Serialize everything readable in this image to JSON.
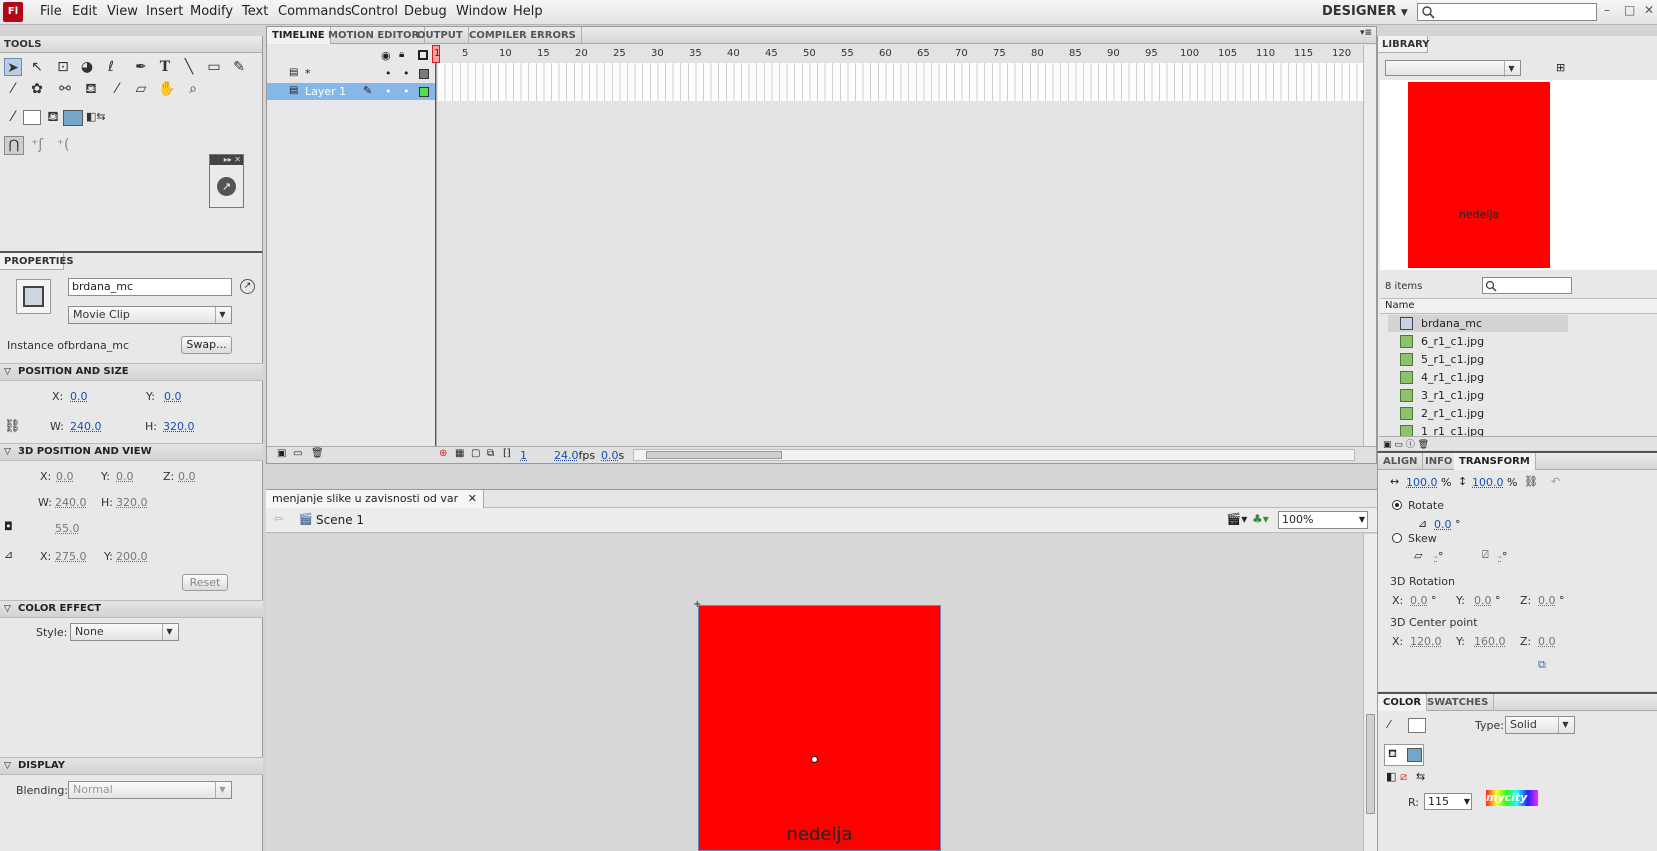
{
  "app": {
    "logo": "Fl",
    "menu": [
      "File",
      "Edit",
      "View",
      "Insert",
      "Modify",
      "Text",
      "Commands",
      "Control",
      "Debug",
      "Window",
      "Help"
    ],
    "workspace": "DESIGNER",
    "window_controls": [
      "–",
      "□",
      "✕"
    ]
  },
  "tools": {
    "header": "TOOLS",
    "icons": [
      "selection-tool",
      "subselection-tool",
      "free-transform-tool",
      "3d-rotation-tool",
      "lasso-tool",
      "pen-tool",
      "text-tool",
      "line-tool",
      "rectangle-tool",
      "pencil-tool",
      "brush-tool",
      "deco-tool",
      "bone-tool",
      "paint-bucket-tool",
      "eyedropper-tool",
      "eraser-tool",
      "hand-tool",
      "zoom-tool"
    ]
  },
  "timeline": {
    "tabs": [
      "TIMELINE",
      "MOTION EDITOR",
      "OUTPUT",
      "COMPILER ERRORS"
    ],
    "frame_numbers": [
      "1",
      "5",
      "10",
      "15",
      "20",
      "25",
      "30",
      "35",
      "40",
      "45",
      "50",
      "55",
      "60",
      "65",
      "70",
      "75",
      "80",
      "85",
      "90",
      "95",
      "100",
      "105",
      "110",
      "115",
      "120"
    ],
    "layers": [
      {
        "name": "*",
        "selected": false,
        "color": "#7a7a7a"
      },
      {
        "name": "Layer 1",
        "selected": true,
        "color": "#4fe04f"
      }
    ],
    "current_frame": "1",
    "fps": "24.0",
    "fps_unit": "fps",
    "elapsed": "0.0",
    "elapsed_unit": "s"
  },
  "document": {
    "tab_title": "menjanje slike u zavisnosti od var",
    "scene": "Scene 1",
    "zoom": "100%",
    "stage_text": "nedelja"
  },
  "properties": {
    "header": "PROPERTIES",
    "instance_name": "brdana_mc",
    "symbol_type": "Movie Clip",
    "instance_of_label": "Instance of:",
    "instance_of": "brdana_mc",
    "swap_button": "Swap...",
    "position_size": {
      "title": "POSITION AND SIZE",
      "x_label": "X:",
      "x": "0.0",
      "y_label": "Y:",
      "y": "0.0",
      "w_label": "W:",
      "w": "240.0",
      "h_label": "H:",
      "h": "320.0"
    },
    "position_3d": {
      "title": "3D POSITION AND VIEW",
      "x_label": "X:",
      "x": "0.0",
      "y_label": "Y:",
      "y": "0.0",
      "z_label": "Z:",
      "z": "0.0",
      "w_label": "W:",
      "w": "240.0",
      "h_label": "H:",
      "h": "320.0",
      "perspective": "55.0",
      "vx_label": "X:",
      "vx": "275.0",
      "vy_label": "Y:",
      "vy": "200.0",
      "reset_button": "Reset"
    },
    "color_effect": {
      "title": "COLOR EFFECT",
      "style_label": "Style:",
      "style": "None"
    },
    "display": {
      "title": "DISPLAY",
      "blending_label": "Blending:",
      "blending": "Normal"
    }
  },
  "library": {
    "header": "LIBRARY",
    "preview_text": "nedelja",
    "item_count": "8 items",
    "column_name": "Name",
    "items": [
      "brdana_mc",
      "6_r1_c1.jpg",
      "5_r1_c1.jpg",
      "4_r1_c1.jpg",
      "3_r1_c1.jpg",
      "2_r1_c1.jpg",
      "1_r1_c1.jpg"
    ]
  },
  "transform": {
    "tabs": [
      "ALIGN",
      "INFO",
      "TRANSFORM"
    ],
    "scale_w": "100.0",
    "scale_h": "100.0",
    "pct": "%",
    "rotate_label": "Rotate",
    "rotate_value": "0.0",
    "deg": "°",
    "skew_label": "Skew",
    "skew_h": "-",
    "skew_v": "-",
    "rotation3d_label": "3D Rotation",
    "rot_x_label": "X:",
    "rot_x": "0.0",
    "rot_y_label": "Y:",
    "rot_y": "0.0",
    "rot_z_label": "Z:",
    "rot_z": "0.0",
    "center_label": "3D Center point",
    "cp_x_label": "X:",
    "cp_x": "120.0",
    "cp_y_label": "Y:",
    "cp_y": "160.0",
    "cp_z_label": "Z:",
    "cp_z": "0.0"
  },
  "color": {
    "tabs": [
      "COLOR",
      "SWATCHES"
    ],
    "type_label": "Type:",
    "type": "Solid",
    "r_label": "R:",
    "r_value": "115",
    "fill_color": "#73a6c9",
    "stroke_color": "#ffffff"
  },
  "watermark": "mycity"
}
